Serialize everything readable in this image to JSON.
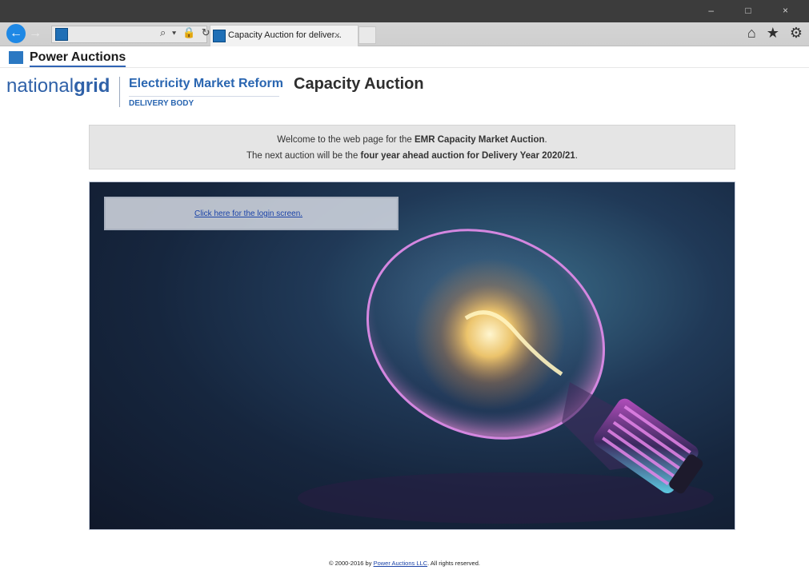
{
  "browser": {
    "tab_title": "Capacity Auction for deliver...",
    "tab_close_glyph": "×",
    "back_glyph": "←",
    "forward_glyph": "→",
    "address_icons": "⌕ ▾ 🔒 ↻",
    "window_controls": "– □ ×",
    "toolbar_icons": "⌂ ★ ⚙"
  },
  "app": {
    "name": "Power Auctions"
  },
  "header": {
    "logo_light": "national",
    "logo_bold": "grid",
    "emr_title": "Electricity Market Reform",
    "emr_subtitle": "DELIVERY BODY",
    "page_heading": "Capacity Auction"
  },
  "welcome": {
    "line1_prefix": "Welcome to the web page for the ",
    "line1_bold": "EMR Capacity Market Auction",
    "line1_suffix": ".",
    "line2_prefix": "The next auction will be the ",
    "line2_bold": "four year ahead auction for Delivery Year 2020/21",
    "line2_suffix": "."
  },
  "login": {
    "link_text": "Click here for the login screen."
  },
  "footer": {
    "prefix": "© 2000-2016 by ",
    "link_text": "Power Auctions LLC",
    "suffix": ". All rights reserved."
  },
  "colors": {
    "brand_blue": "#2a66b1",
    "link_blue": "#1b43a8",
    "panel_gray": "#e5e5e5"
  },
  "icons": [
    "back-arrow-icon",
    "forward-arrow-icon",
    "search-icon",
    "lock-icon",
    "refresh-icon",
    "home-icon",
    "star-icon",
    "gear-icon",
    "lightbulb-image"
  ]
}
